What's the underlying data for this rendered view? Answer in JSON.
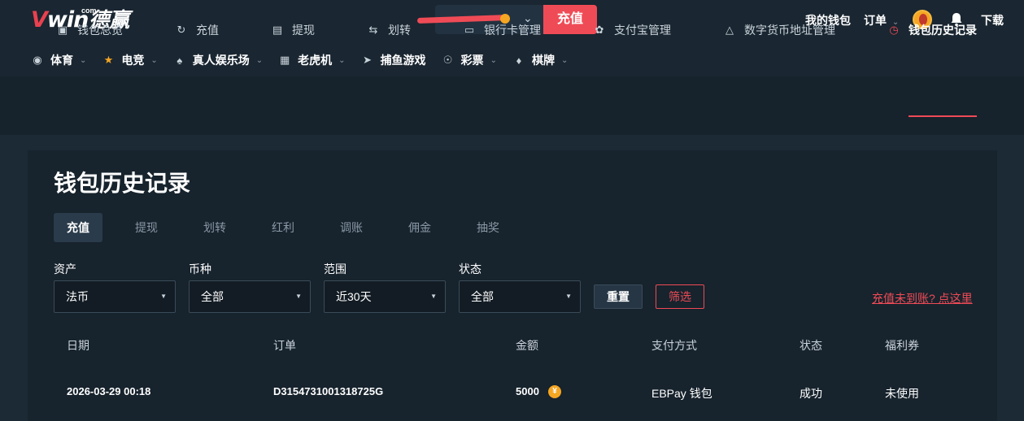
{
  "header": {
    "logo_v": "V",
    "logo_win": "win",
    "logo_com": "com",
    "logo_cn": "德赢",
    "deposit_label": "充值",
    "wallet_link": "我的钱包",
    "orders_link": "订单",
    "download_link": "下载"
  },
  "game_nav": [
    {
      "label": "体育",
      "icon": "basketball-icon"
    },
    {
      "label": "电竞",
      "icon": "trophy-icon"
    },
    {
      "label": "真人娱乐场",
      "icon": "spade-icon"
    },
    {
      "label": "老虎机",
      "icon": "slot-machine-icon"
    },
    {
      "label": "捕鱼游戏",
      "icon": "fish-icon"
    },
    {
      "label": "彩票",
      "icon": "lottery-ball-icon"
    },
    {
      "label": "棋牌",
      "icon": "cards-icon"
    }
  ],
  "wallet_nav": [
    {
      "label": "钱包总览",
      "icon": "wallet-icon"
    },
    {
      "label": "充值",
      "icon": "deposit-icon"
    },
    {
      "label": "提现",
      "icon": "withdraw-icon"
    },
    {
      "label": "划转",
      "icon": "transfer-icon"
    },
    {
      "label": "银行卡管理",
      "icon": "bank-card-icon"
    },
    {
      "label": "支付宝管理",
      "icon": "alipay-icon"
    },
    {
      "label": "数字货币地址管理",
      "icon": "crypto-address-icon"
    },
    {
      "label": "钱包历史记录",
      "icon": "clock-icon",
      "active": true
    }
  ],
  "page": {
    "title": "钱包历史记录",
    "tabs": [
      "充值",
      "提现",
      "划转",
      "红利",
      "调账",
      "佣金",
      "抽奖"
    ],
    "active_tab": "充值"
  },
  "filters": {
    "asset": {
      "label": "资产",
      "value": "法币"
    },
    "currency": {
      "label": "币种",
      "value": "全部"
    },
    "range": {
      "label": "范围",
      "value": "近30天"
    },
    "status": {
      "label": "状态",
      "value": "全部"
    },
    "reset_label": "重置",
    "filter_label": "筛选",
    "help_link": "充值未到账? 点这里"
  },
  "table": {
    "headers": [
      "日期",
      "订单",
      "金额",
      "支付方式",
      "状态",
      "福利券"
    ],
    "rows": [
      {
        "date": "2026-03-29 00:18",
        "order": "D3154731001318725G",
        "amount": "5000",
        "currency_symbol": "¥",
        "method": "EBPay 钱包",
        "status": "成功",
        "coupon": "未使用"
      }
    ]
  },
  "colors": {
    "accent": "#ef4b56",
    "background": "#1c2a35",
    "panel": "#17232d",
    "coin": "#f5a623"
  }
}
